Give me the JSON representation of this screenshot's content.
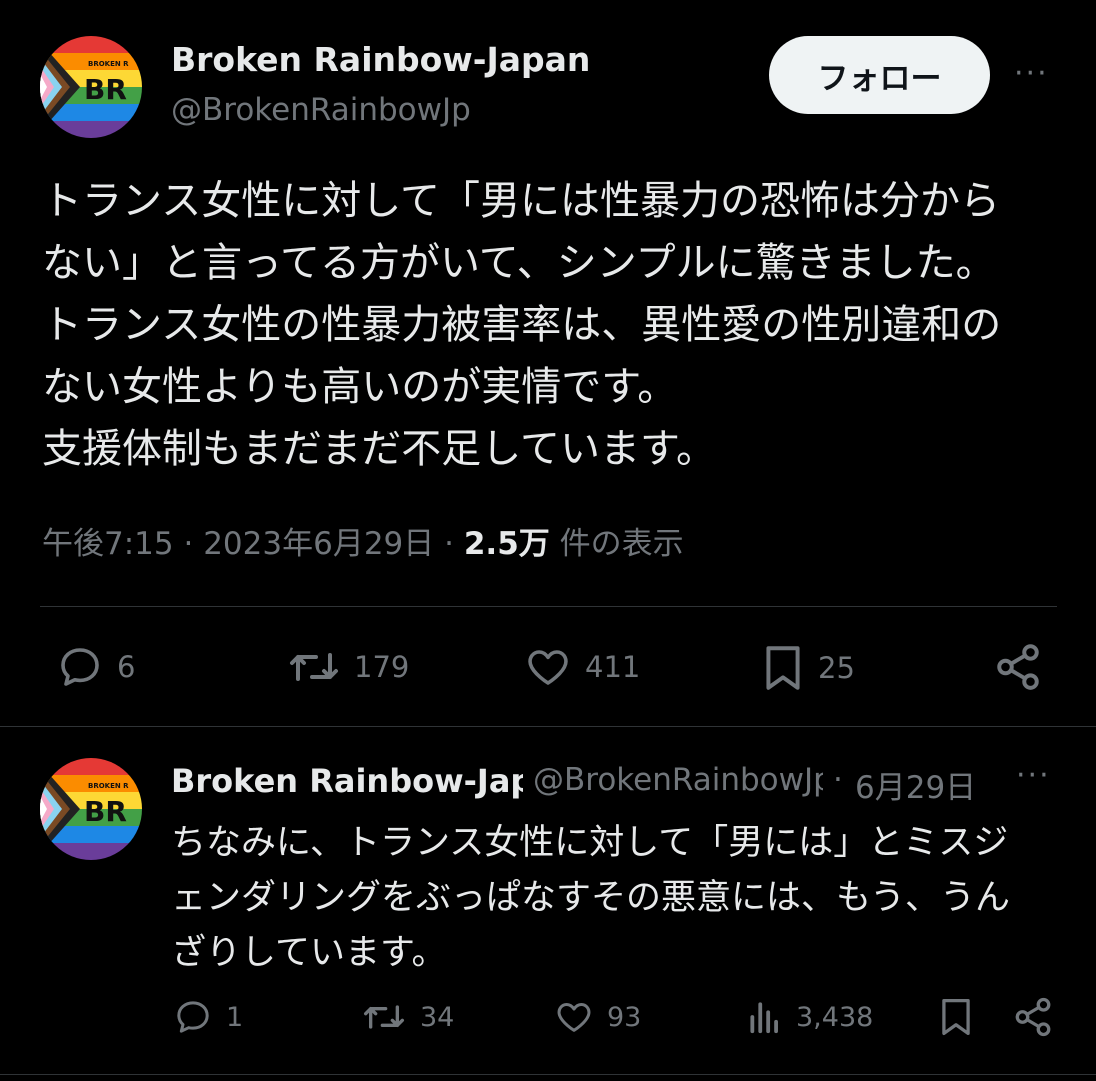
{
  "main_tweet": {
    "author_name": "Broken Rainbow-Japan",
    "handle": "@BrokenRainbowJp",
    "follow_label": "フォロー",
    "more_label": "···",
    "text_lines": [
      "トランス女性に対して「男には性暴力の恐怖は分から",
      "ない」と言ってる方がいて、シンプルに驚きました。",
      "トランス女性の性暴力被害率は、異性愛の性別違和の",
      "ない女性よりも高いのが実情です。",
      "支援体制もまだまだ不足しています。"
    ],
    "time": "午後7:15",
    "date": "2023年6月29日",
    "separator": "·",
    "views_count": "2.5万",
    "views_label": "件の表示",
    "stats": {
      "replies": "6",
      "retweets": "179",
      "likes": "411",
      "bookmarks": "25"
    }
  },
  "reply_tweet": {
    "author_name": "Broken Rainbow-Japan",
    "handle": "@BrokenRainbowJp",
    "separator": "·",
    "date": "6月29日",
    "more_label": "···",
    "text_lines": [
      "ちなみに、トランス女性に対して「男には」とミスジ",
      "ェンダリングをぶっぱなすその悪意には、もう、うん",
      "ざりしています。"
    ],
    "stats": {
      "replies": "1",
      "retweets": "34",
      "likes": "93",
      "views": "3,438"
    }
  },
  "avatar": {
    "logo_text": "BR",
    "logo_small_text": "BROKEN R",
    "colors": [
      "#e53935",
      "#fb8c00",
      "#fdd835",
      "#43a047",
      "#1e88e5",
      "#6a3d9a"
    ]
  }
}
